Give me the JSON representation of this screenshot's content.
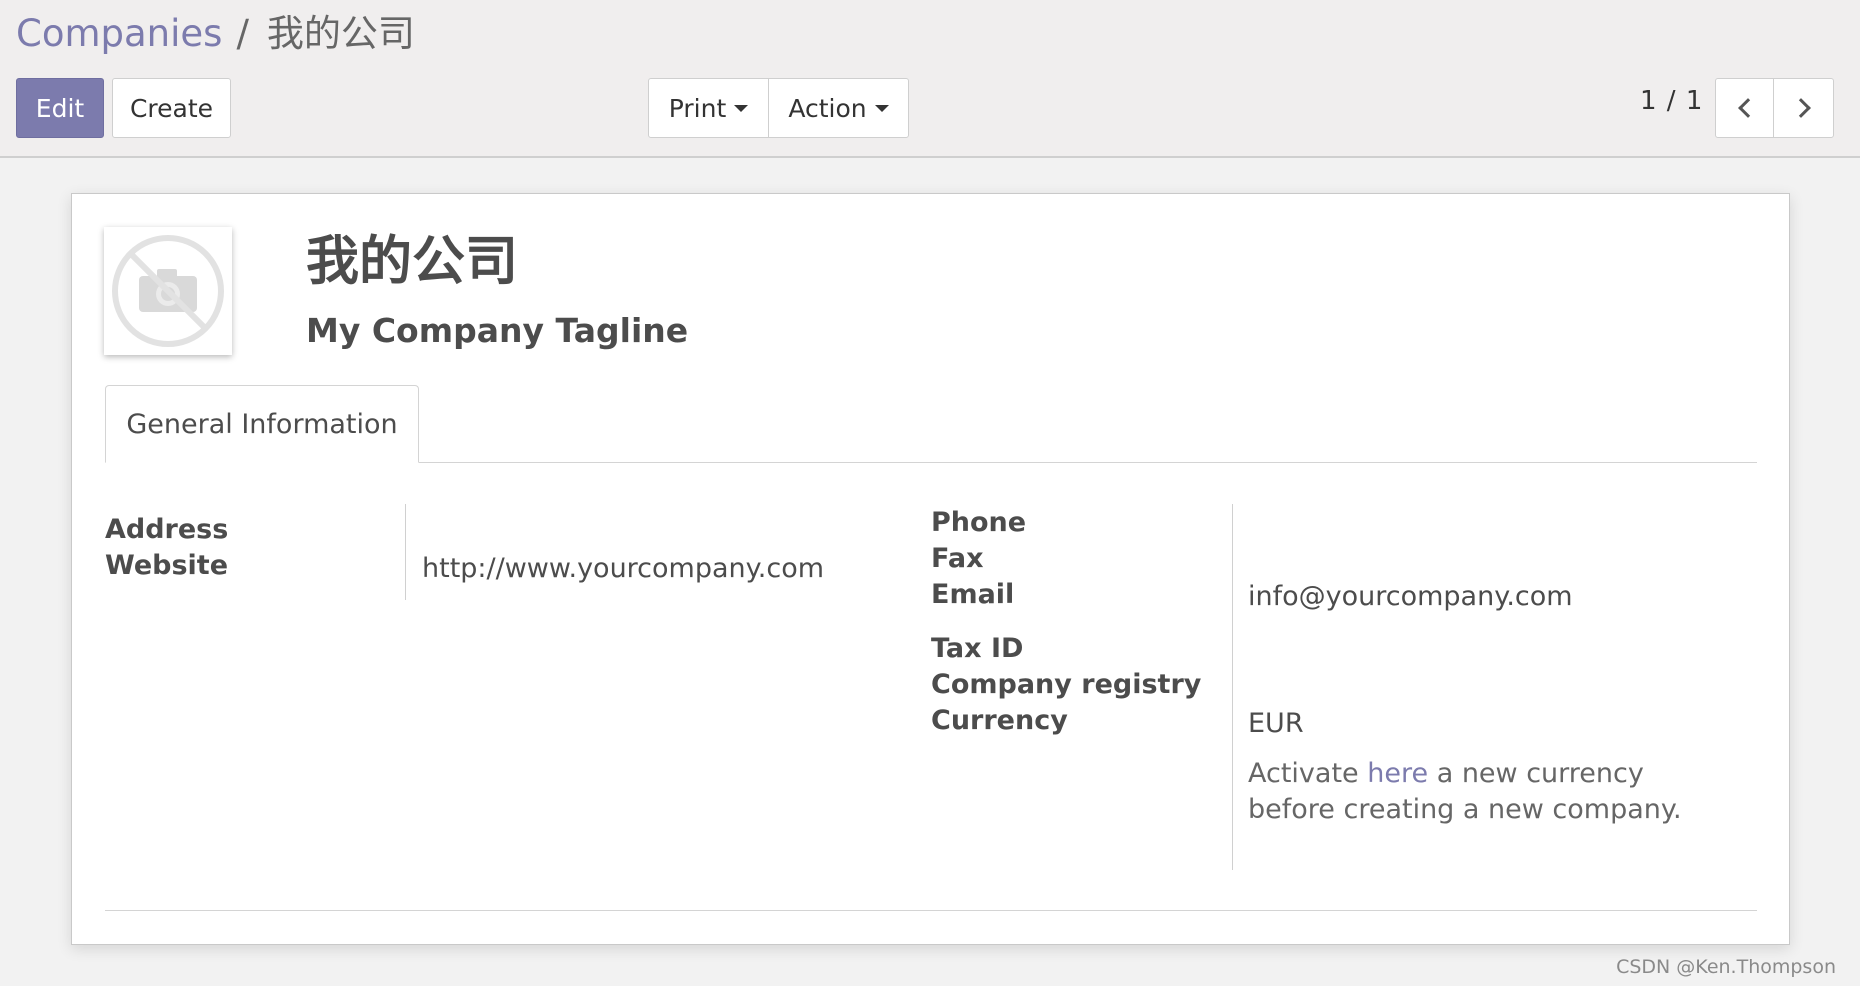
{
  "breadcrumb": {
    "parent": "Companies",
    "separator": "/",
    "current": "我的公司"
  },
  "toolbar": {
    "edit_label": "Edit",
    "create_label": "Create",
    "print_label": "Print",
    "action_label": "Action"
  },
  "pager": {
    "value": "1 / 1"
  },
  "record": {
    "name": "我的公司",
    "tagline": "My Company Tagline"
  },
  "tabs": [
    {
      "label": "General Information"
    }
  ],
  "fields_left": {
    "address_label": "Address",
    "website_label": "Website",
    "website_value": "http://www.yourcompany.com"
  },
  "fields_right": {
    "phone_label": "Phone",
    "fax_label": "Fax",
    "email_label": "Email",
    "email_value": "info@yourcompany.com",
    "taxid_label": "Tax ID",
    "registry_label": "Company registry",
    "currency_label": "Currency",
    "currency_value": "EUR"
  },
  "currency_notice": {
    "prefix": "Activate",
    "link": "here",
    "suffix": "a new currency",
    "line2": "before creating a new company."
  },
  "watermark": "CSDN @Ken.Thompson",
  "colors": {
    "accent": "#7c7bad",
    "panel_bg": "#f0eeee",
    "page_bg": "#f2f2f2",
    "text": "#4c4c4c"
  }
}
